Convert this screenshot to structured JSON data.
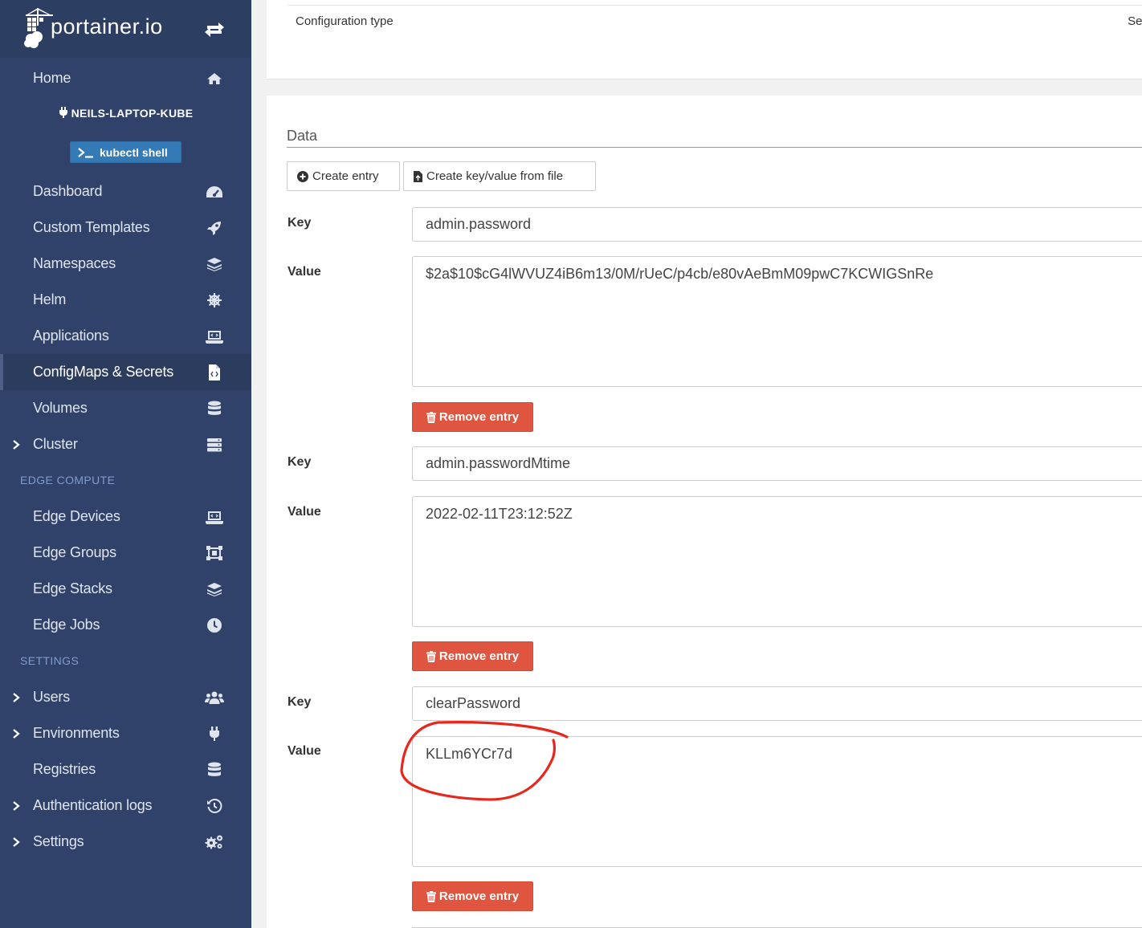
{
  "brand": {
    "name": "portainer.io"
  },
  "sidebar": {
    "home": "Home",
    "environment": "NEILS-LAPTOP-KUBE",
    "kubectl": "kubectl shell",
    "items": [
      {
        "label": "Dashboard",
        "icon": "tachometer-icon"
      },
      {
        "label": "Custom Templates",
        "icon": "rocket-icon"
      },
      {
        "label": "Namespaces",
        "icon": "layers-icon"
      },
      {
        "label": "Helm",
        "icon": "helm-icon"
      },
      {
        "label": "Applications",
        "icon": "laptop-code-icon"
      },
      {
        "label": "ConfigMaps & Secrets",
        "icon": "file-code-icon"
      },
      {
        "label": "Volumes",
        "icon": "database-icon"
      },
      {
        "label": "Cluster",
        "icon": "server-icon"
      }
    ],
    "edge_title": "EDGE COMPUTE",
    "edge_items": [
      {
        "label": "Edge Devices",
        "icon": "laptop-icon"
      },
      {
        "label": "Edge Groups",
        "icon": "object-group-icon"
      },
      {
        "label": "Edge Stacks",
        "icon": "layers-icon"
      },
      {
        "label": "Edge Jobs",
        "icon": "clock-icon"
      }
    ],
    "settings_title": "SETTINGS",
    "settings_items": [
      {
        "label": "Users",
        "icon": "users-icon"
      },
      {
        "label": "Environments",
        "icon": "plug-icon"
      },
      {
        "label": "Registries",
        "icon": "database-icon"
      },
      {
        "label": "Authentication logs",
        "icon": "history-icon"
      },
      {
        "label": "Settings",
        "icon": "cogs-icon"
      }
    ]
  },
  "main": {
    "config_type_label": "Configuration type",
    "config_type_value": "Sec",
    "data_title": "Data",
    "create_entry": "Create entry",
    "create_from_file": "Create key/value from file",
    "key_label": "Key",
    "value_label": "Value",
    "remove_label": "Remove entry",
    "entries": [
      {
        "key": "admin.password",
        "value": "$2a$10$cG4lWVUZ4iB6m13/0M/rUeC/p4cb/e80vAeBmM09pwC7KCWIGSnRe"
      },
      {
        "key": "admin.passwordMtime",
        "value": "2022-02-11T23:12:52Z"
      },
      {
        "key": "clearPassword",
        "value": "KLLm6YCr7d"
      }
    ]
  },
  "colors": {
    "sidebar_bg": "#30426a",
    "accent_blue": "#337ab7",
    "danger": "#e0553f",
    "annotation": "#e8261c"
  }
}
